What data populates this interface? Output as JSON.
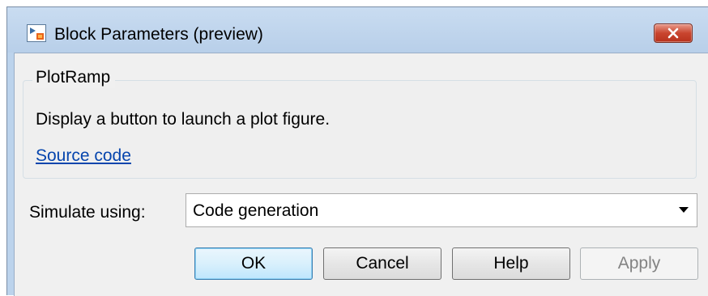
{
  "window": {
    "title": "Block Parameters (preview)",
    "icon": "simulink-block-icon",
    "close_icon": "close-icon"
  },
  "block": {
    "name": "PlotRamp",
    "description": "Display a button to launch a plot figure.",
    "source_link": "Source code"
  },
  "simulate": {
    "label": "Simulate using:",
    "selected": "Code generation"
  },
  "buttons": {
    "ok": "OK",
    "cancel": "Cancel",
    "help": "Help",
    "apply": "Apply"
  },
  "colors": {
    "titlebar": "#bcd3ec",
    "close_button": "#c9452f",
    "link": "#0645ad",
    "disabled_text": "#838383"
  }
}
